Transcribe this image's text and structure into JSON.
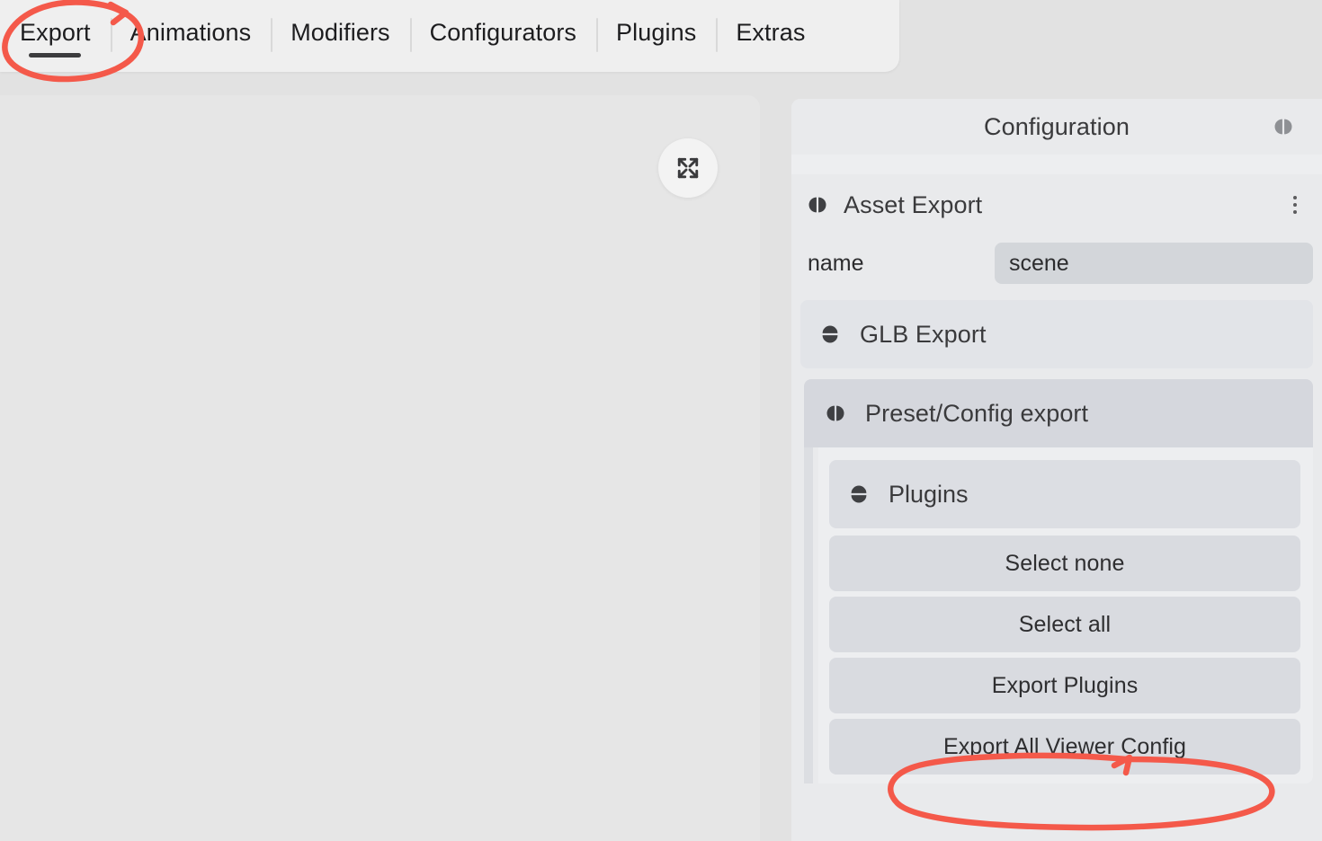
{
  "tabs": [
    {
      "label": "Export",
      "active": true
    },
    {
      "label": "Animations",
      "active": false
    },
    {
      "label": "Modifiers",
      "active": false
    },
    {
      "label": "Configurators",
      "active": false
    },
    {
      "label": "Plugins",
      "active": false
    },
    {
      "label": "Extras",
      "active": false
    }
  ],
  "viewport": {
    "fullscreen_icon": "fullscreen-expand-icon"
  },
  "config": {
    "title": "Configuration",
    "collapse_icon": "split-circle-vertical-icon",
    "sections": {
      "asset_export": {
        "title": "Asset Export",
        "expand_icon": "split-circle-vertical-icon",
        "menu_icon": "kebab-menu-icon",
        "properties": [
          {
            "label": "name",
            "value": "scene",
            "placeholder": "scene"
          }
        ],
        "glb_export": {
          "title": "GLB Export",
          "expand_icon": "split-circle-horizontal-icon",
          "collapsed": true
        },
        "preset_config_export": {
          "title": "Preset/Config export",
          "expand_icon": "split-circle-vertical-icon",
          "collapsed": false,
          "plugins": {
            "title": "Plugins",
            "expand_icon": "split-circle-horizontal-icon",
            "collapsed": true
          },
          "buttons": [
            {
              "label": "Select none"
            },
            {
              "label": "Select all"
            },
            {
              "label": "Export Plugins"
            },
            {
              "label": "Export All Viewer Config"
            }
          ]
        }
      }
    }
  },
  "annotations": {
    "accent_color": "#f4594a",
    "marks": [
      {
        "name": "circle-around-export-tab",
        "shape": "ellipse-with-arrow",
        "target": "Export"
      },
      {
        "name": "circle-around-export-all-viewer-config",
        "shape": "ellipse-with-arrow",
        "target": "Export All Viewer Config"
      }
    ]
  },
  "colors": {
    "page_background": "#e2e2e2",
    "tabbar_background": "#efefef",
    "viewport_background": "#e6e6e6",
    "panel_background": "#e9eaec",
    "band_background": "#d5d7dd",
    "button_background": "#d9dbe0",
    "input_background": "#d3d6da",
    "text_primary": "#2c2c2e",
    "text_secondary": "#3a3a3c",
    "accent_red": "#f4594a"
  }
}
